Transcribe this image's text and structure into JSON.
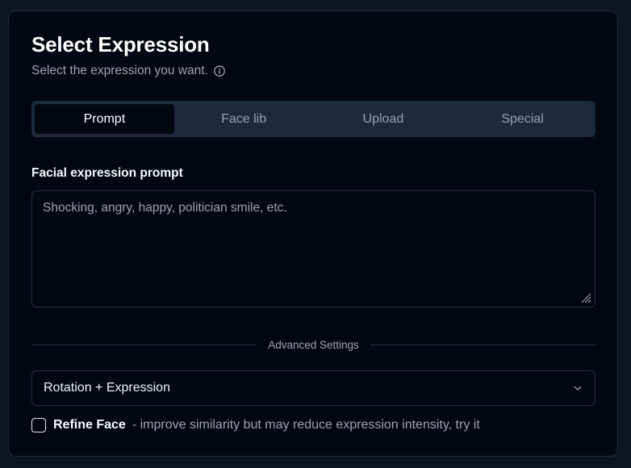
{
  "header": {
    "title": "Select Expression",
    "subtitle": "Select the expression you want.",
    "info_icon": "info-circle-icon"
  },
  "tabs": [
    {
      "label": "Prompt",
      "active": true
    },
    {
      "label": "Face lib",
      "active": false
    },
    {
      "label": "Upload",
      "active": false
    },
    {
      "label": "Special",
      "active": false
    }
  ],
  "prompt": {
    "label": "Facial expression prompt",
    "value": "",
    "placeholder": "Shocking, angry, happy, politician smile, etc."
  },
  "advanced": {
    "label": "Advanced Settings"
  },
  "mode_select": {
    "value": "Rotation + Expression",
    "icon": "chevron-down-icon"
  },
  "refine": {
    "checked": false,
    "label": "Refine Face",
    "hint": "- improve similarity but may reduce expression intensity, try it"
  },
  "colors": {
    "background": "#0f1422",
    "card": "#030712",
    "tab_bar": "#1e293b",
    "muted_text": "#9ca3af"
  }
}
